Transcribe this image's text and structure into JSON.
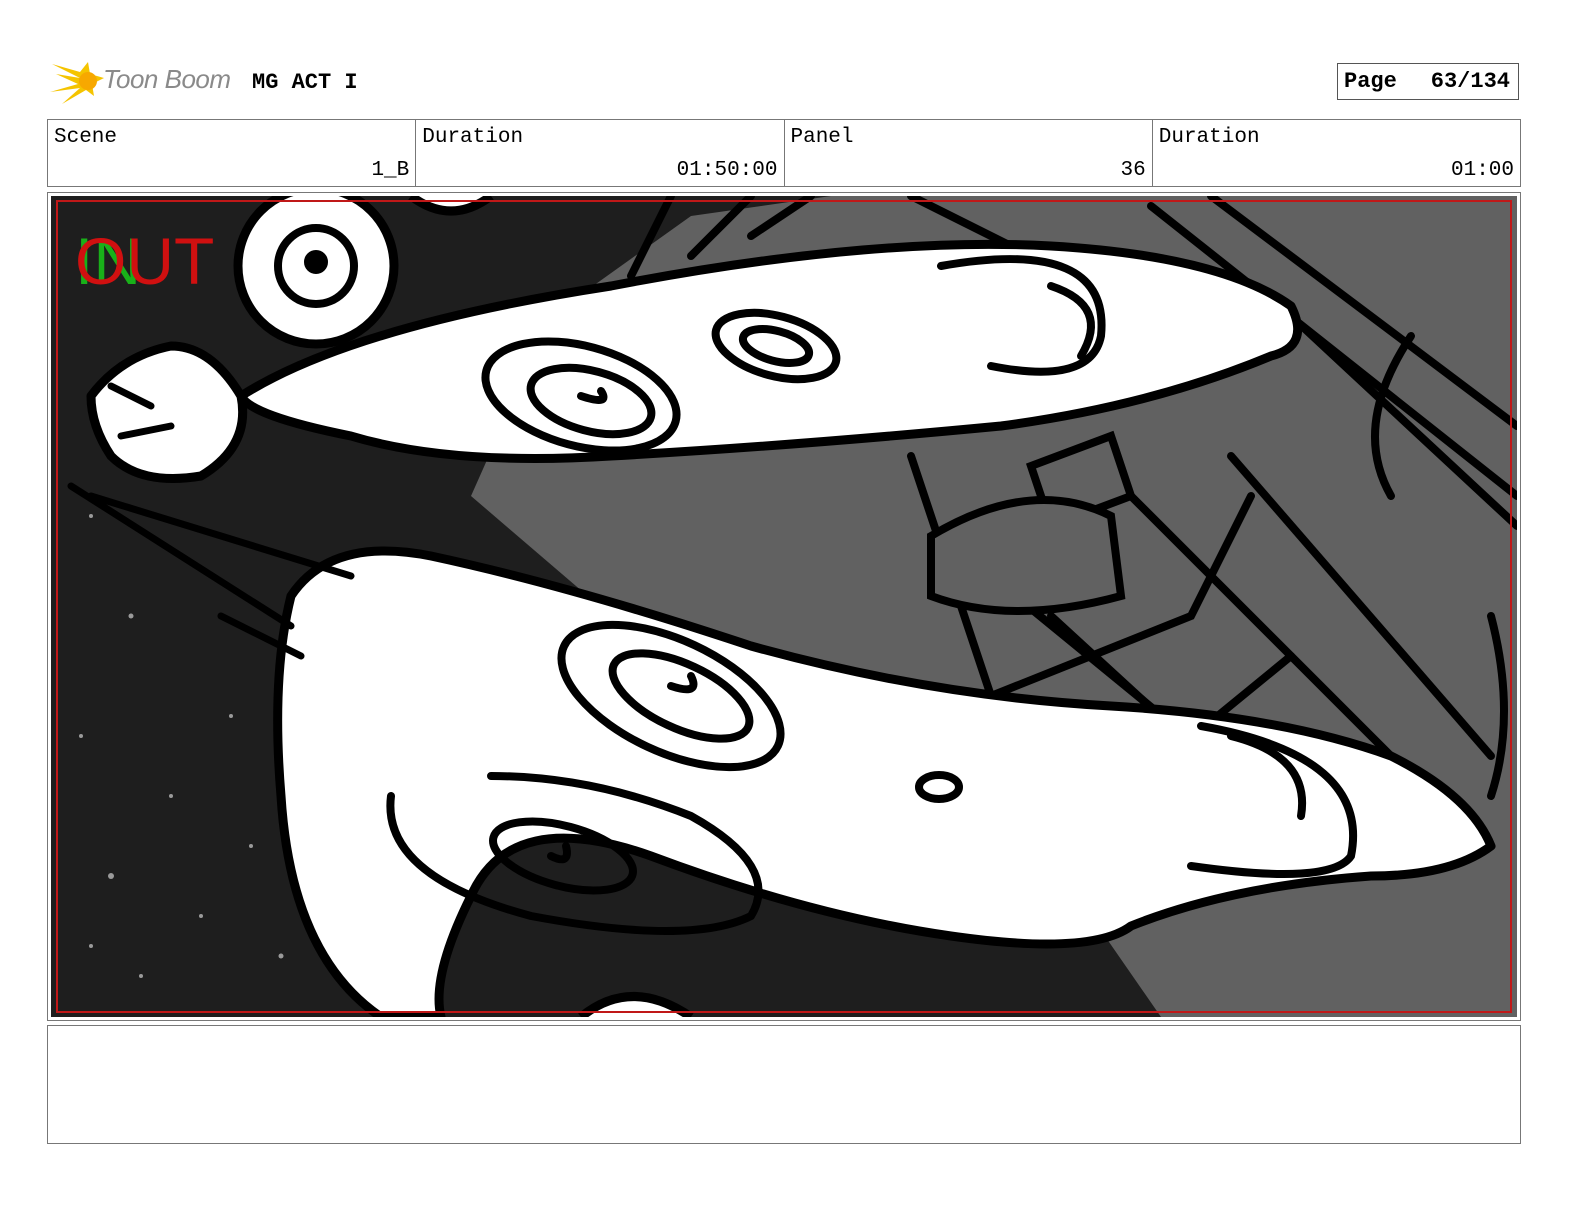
{
  "header": {
    "brand": "Toon Boom",
    "project": "MG ACT I",
    "page_label": "Page",
    "page_value": "63/134"
  },
  "info": {
    "scene_label": "Scene",
    "scene_value": "1_B",
    "scene_duration_label": "Duration",
    "scene_duration_value": "01:50:00",
    "panel_label": "Panel",
    "panel_value": "36",
    "panel_duration_label": "Duration",
    "panel_duration_value": "01:00"
  },
  "panel": {
    "overlay_in": "IN",
    "overlay_out": "OUT"
  },
  "notes": {
    "text": ""
  },
  "colors": {
    "logo_yellow": "#f5c400",
    "brand_gray": "#8a8a8a",
    "safe_area_red": "#c01818",
    "in_green": "#19b019",
    "out_red": "#d01010",
    "space_dark": "#1e1e1e",
    "hull_gray": "#616161"
  }
}
